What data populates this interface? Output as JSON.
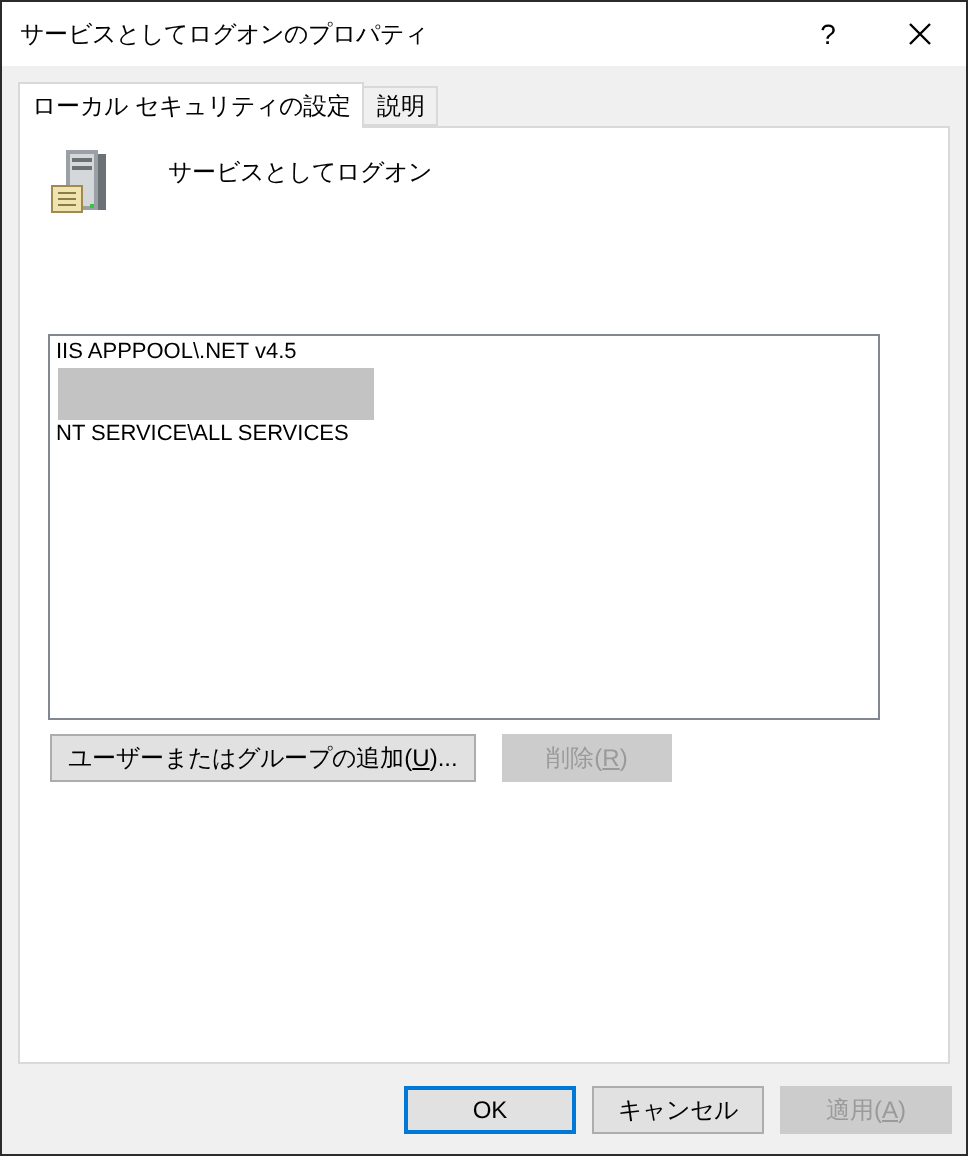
{
  "window": {
    "title": "サービスとしてログオンのプロパティ",
    "help": "?"
  },
  "tabs": [
    {
      "label": "ローカル セキュリティの設定",
      "selected": true
    },
    {
      "label": "説明",
      "selected": false
    }
  ],
  "policy": {
    "name": "サービスとしてログオン"
  },
  "accounts": [
    {
      "kind": "account",
      "name": "IIS APPPOOL\\.NET v4.5"
    },
    {
      "kind": "redacted"
    },
    {
      "kind": "account",
      "name": "NT SERVICE\\ALL SERVICES"
    }
  ],
  "list_buttons": [
    {
      "label": "ユーザーまたはグループの追加(",
      "key": "U",
      "after": ")...",
      "disabled": false
    },
    {
      "label": "削除(",
      "key": "R",
      "after": ")",
      "disabled": true
    }
  ],
  "dialog_buttons": [
    {
      "label": "OK",
      "disabled": false,
      "default": true
    },
    {
      "label": "キャンセル",
      "disabled": false,
      "default": false
    },
    {
      "label": "適用(",
      "key": "A",
      "after": ")",
      "disabled": true,
      "default": false
    }
  ]
}
